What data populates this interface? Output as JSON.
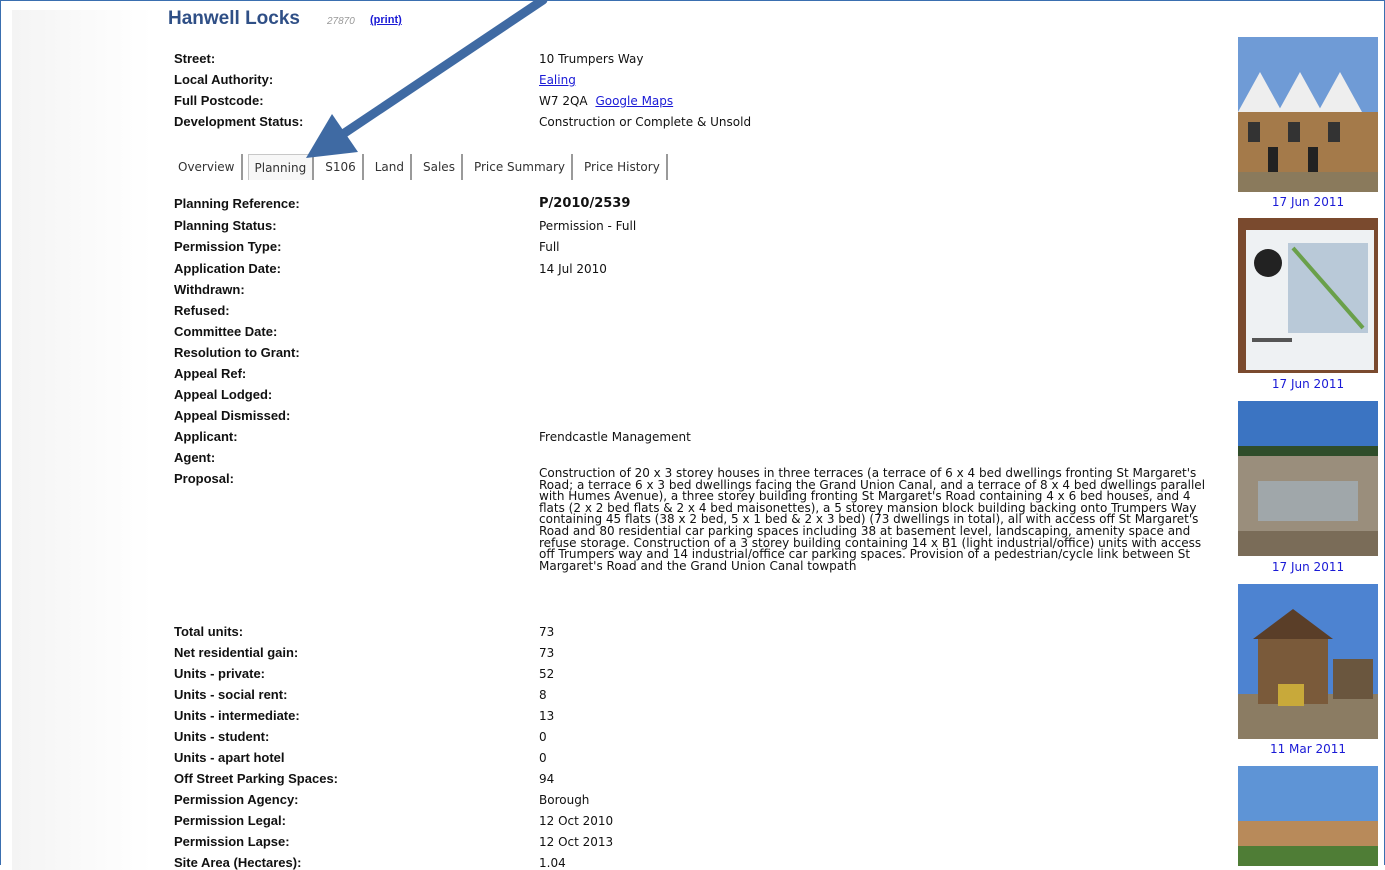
{
  "header": {
    "title": "Hanwell Locks",
    "ref_number": "27870",
    "print_link": "(print)"
  },
  "overview": {
    "street_label": "Street:",
    "street_value": "10 Trumpers Way",
    "authority_label": "Local Authority:",
    "authority_value": "Ealing",
    "postcode_label": "Full Postcode:",
    "postcode_value": "W7 2QA",
    "maps_link": "Google Maps",
    "status_label": "Development Status:",
    "status_value": "Construction or Complete & Unsold"
  },
  "tabs": [
    {
      "label": "Overview",
      "active": false
    },
    {
      "label": "Planning",
      "active": true
    },
    {
      "label": "S106",
      "active": false
    },
    {
      "label": "Land",
      "active": false
    },
    {
      "label": "Sales",
      "active": false
    },
    {
      "label": "Price Summary",
      "active": false
    },
    {
      "label": "Price History",
      "active": false
    }
  ],
  "planning": {
    "rows": [
      {
        "label": "Planning Reference:",
        "value": "P/2010/2539"
      },
      {
        "label": "Planning Status:",
        "value": "Permission - Full"
      },
      {
        "label": "Permission Type:",
        "value": "Full"
      },
      {
        "label": "Application Date:",
        "value": "14 Jul 2010"
      },
      {
        "label": "Withdrawn:",
        "value": ""
      },
      {
        "label": "Refused:",
        "value": ""
      },
      {
        "label": "Committee Date:",
        "value": ""
      },
      {
        "label": "Resolution to Grant:",
        "value": ""
      },
      {
        "label": "Appeal Ref:",
        "value": ""
      },
      {
        "label": "Appeal Lodged:",
        "value": ""
      },
      {
        "label": "Appeal Dismissed:",
        "value": ""
      },
      {
        "label": "Applicant:",
        "value": "Frendcastle Management"
      },
      {
        "label": "Agent:",
        "value": ""
      }
    ],
    "proposal_label": "Proposal:",
    "proposal_text": "Construction of 20 x 3 storey houses in three terraces (a terrace of 6 x 4 bed dwellings fronting St Margaret's Road; a terrace 6 x 3 bed dwellings facing the Grand Union Canal, and a terrace of 8 x 4 bed dwellings parallel with Humes Avenue), a three storey building fronting St Margaret's Road containing 4 x 6 bed houses, and 4 flats (2 x 2 bed flats & 2 x 4 bed maisonettes), a 5 storey mansion block building backing onto Trumpers Way containing 45 flats (38 x 2 bed, 5 x 1 bed & 2 x 3 bed) (73 dwellings in total), all with access off St Margaret's Road and 80 residential car parking spaces including 38 at basement level, landscaping, amenity space and refuse storage. Construction of a 3 storey building containing 14 x B1 (light industrial/office) units with access off Trumpers way and 14 industrial/office car parking spaces. Provision of a pedestrian/cycle link between St Margaret's Road and the Grand Union Canal towpath",
    "units": [
      {
        "label": "Total units:",
        "value": "73"
      },
      {
        "label": "Net residential gain:",
        "value": "73"
      },
      {
        "label": "Units - private:",
        "value": "52"
      },
      {
        "label": "Units - social rent:",
        "value": "8"
      },
      {
        "label": "Units - intermediate:",
        "value": "13"
      },
      {
        "label": "Units - student:",
        "value": "0"
      },
      {
        "label": "Units - apart hotel",
        "value": "0"
      },
      {
        "label": "Off Street Parking Spaces:",
        "value": "94"
      },
      {
        "label": "Permission Agency:",
        "value": "Borough"
      },
      {
        "label": "Permission Legal:",
        "value": "12 Oct 2010"
      },
      {
        "label": "Permission Lapse:",
        "value": "12 Oct 2013"
      },
      {
        "label": "Site Area (Hectares):",
        "value": "1.04"
      }
    ]
  },
  "photos": [
    {
      "caption": "17 Jun 2011"
    },
    {
      "caption": "17 Jun 2011"
    },
    {
      "caption": "17 Jun 2011"
    },
    {
      "caption": "11 Mar 2011"
    },
    {
      "caption": ""
    }
  ],
  "colors": {
    "title": "#2f4f86",
    "link": "#1a1ad6",
    "arrow": "#3f6aa3"
  }
}
